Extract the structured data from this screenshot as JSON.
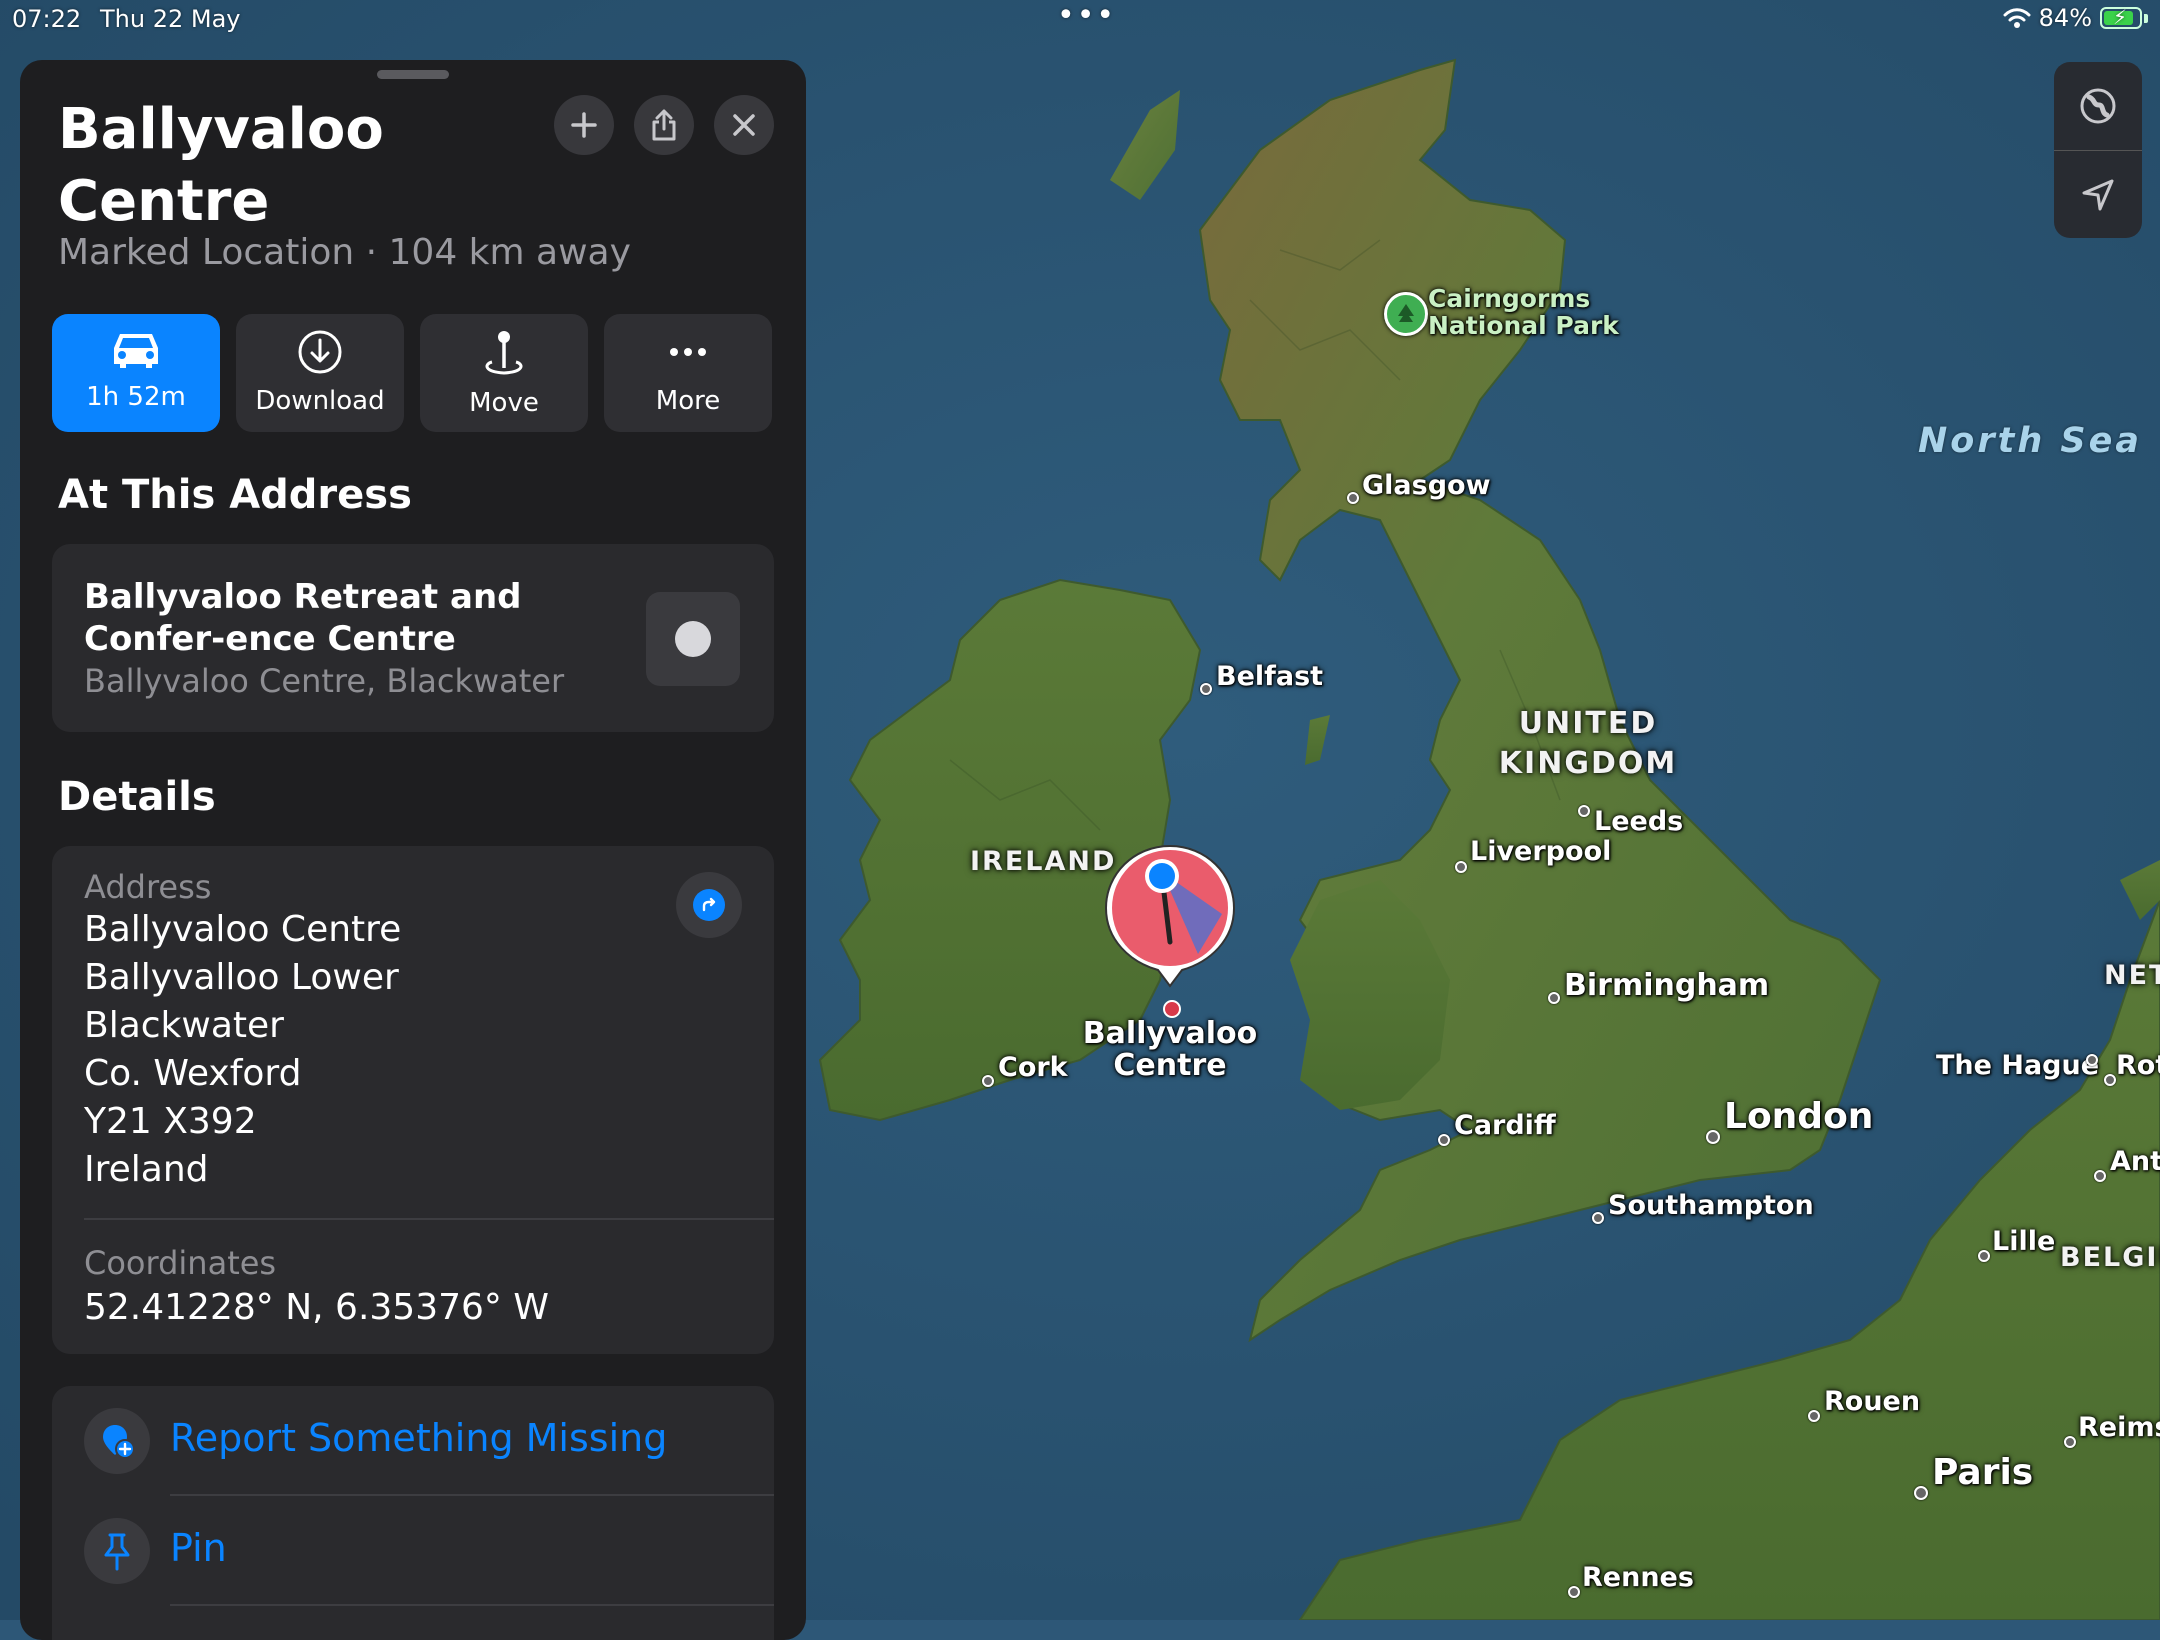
{
  "status_bar": {
    "time": "07:22",
    "date": "Thu 22 May",
    "dots": "•••",
    "battery": "84%",
    "battery_level": 0.84
  },
  "panel": {
    "title": "Ballyvaloo Centre",
    "subtitle": "Marked Location · 104 km away",
    "header_buttons": {
      "add_icon": "plus-icon",
      "share_icon": "share-icon",
      "close_icon": "close-icon"
    },
    "actions": [
      {
        "label": "1h 52m",
        "icon": "car-icon",
        "primary": true
      },
      {
        "label": "Download",
        "icon": "download-icon"
      },
      {
        "label": "Move",
        "icon": "move-pin-icon"
      },
      {
        "label": "More",
        "icon": "more-icon"
      }
    ],
    "at_address": {
      "heading": "At This Address",
      "name": "Ballyvaloo Retreat and Confer-ence Centre",
      "sub": "Ballyvaloo Centre, Blackwater"
    },
    "details": {
      "heading": "Details",
      "address_label": "Address",
      "address_lines": [
        "Ballyvaloo Centre",
        "Ballyvalloo Lower",
        "Blackwater",
        "Co. Wexford",
        "Y21 X392",
        "Ireland"
      ],
      "coordinates_label": "Coordinates",
      "coordinates": "52.41228° N, 6.35376° W"
    },
    "links": [
      {
        "label": "Report Something Missing",
        "icon": "report-location-icon"
      },
      {
        "label": "Pin",
        "icon": "pin-icon"
      }
    ]
  },
  "map": {
    "sea": "North Sea",
    "countries": [
      "UNITED KINGDOM",
      "IRELAND",
      "NET",
      "BELGIU"
    ],
    "park": "Cairngorms National Park",
    "marker_label": "Ballyvaloo Centre",
    "cities": [
      "Glasgow",
      "Belfast",
      "Leeds",
      "Liverpool",
      "Birmingham",
      "Cork",
      "Cardiff",
      "London",
      "Southampton",
      "The Hague",
      "Rot",
      "Ant",
      "Lille",
      "Rouen",
      "Paris",
      "Reims",
      "Rennes"
    ],
    "controls": [
      "globe-icon",
      "location-arrow-icon"
    ]
  }
}
